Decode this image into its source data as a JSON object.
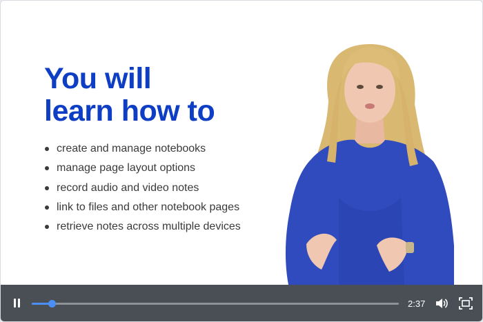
{
  "slide": {
    "headline_line1": "You will",
    "headline_line2": "learn how to",
    "bullets": [
      "create and manage notebooks",
      "manage page layout options",
      "record audio and video notes",
      "link to files and other notebook pages",
      "retrieve notes across multiple devices"
    ],
    "presenter_icon": "presenter-image"
  },
  "player": {
    "time": "2:37",
    "progress": 0.054,
    "pause_icon": "pause-icon",
    "volume_icon": "volume-icon",
    "fullscreen_icon": "fullscreen-icon"
  },
  "colors": {
    "headline": "#0d3ec3",
    "body_text": "#3a3a3a",
    "control_bar": "#4a4f56",
    "progress_accent": "#4b8ef5",
    "dress": "#2f4bbd"
  }
}
